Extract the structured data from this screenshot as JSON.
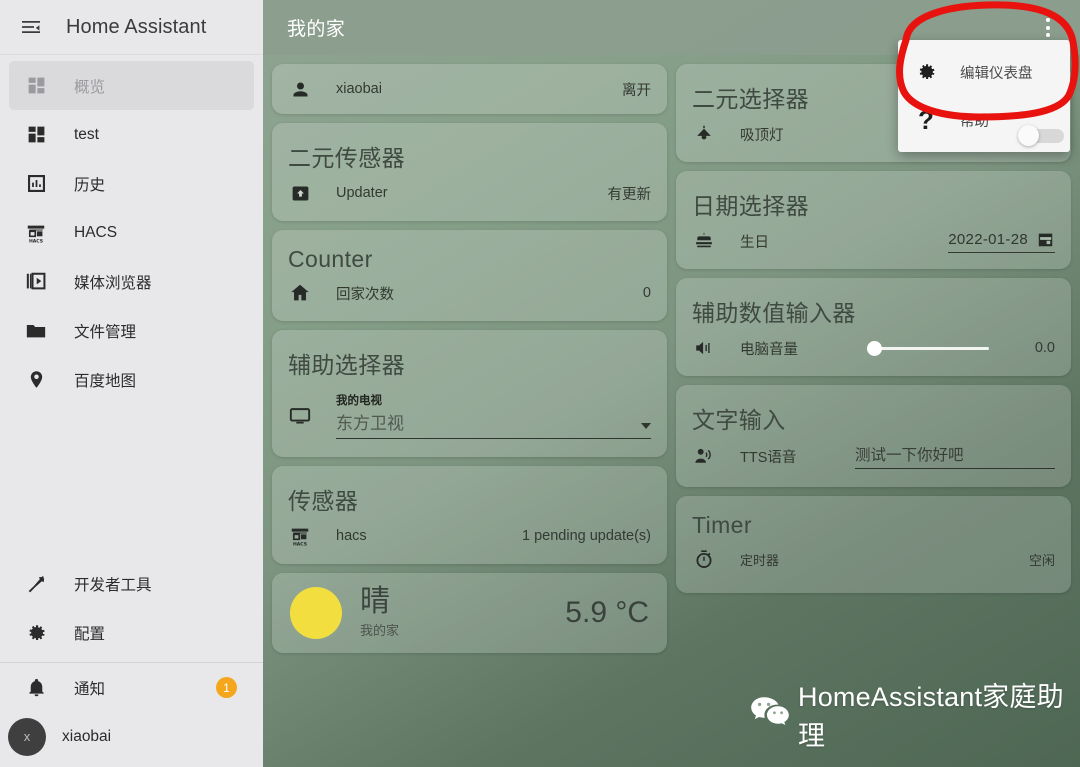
{
  "sidebar": {
    "title": "Home Assistant",
    "menu_icon": "hamburger-collapse-icon",
    "items": [
      {
        "label": "概览",
        "icon": "view-dashboard-icon",
        "active": true
      },
      {
        "label": "test",
        "icon": "view-dashboard-icon",
        "active": false
      },
      {
        "label": "历史",
        "icon": "chart-bar-icon",
        "active": false
      },
      {
        "label": "HACS",
        "icon": "hacs-store-icon",
        "active": false
      },
      {
        "label": "媒体浏览器",
        "icon": "media-library-icon",
        "active": false
      },
      {
        "label": "文件管理",
        "icon": "folder-icon",
        "active": false
      },
      {
        "label": "百度地图",
        "icon": "map-marker-icon",
        "active": false
      }
    ],
    "tools": [
      {
        "label": "开发者工具",
        "icon": "hammer-wrench-icon"
      },
      {
        "label": "配置",
        "icon": "cog-icon"
      }
    ],
    "notifications": {
      "label": "通知",
      "icon": "bell-icon",
      "badge": "1"
    },
    "user": {
      "label": "xiaobai",
      "avatar_initial": "x"
    }
  },
  "topbar": {
    "title": "我的家",
    "overflow_icon": "dots-vertical-icon"
  },
  "menu": {
    "items": [
      {
        "label": "编辑仪表盘",
        "icon": "cog-icon"
      },
      {
        "label": "帮助",
        "icon": "help-question-icon"
      }
    ],
    "toggle_state": "off"
  },
  "annotation": {
    "color": "#e8130f",
    "shape": "hand-drawn-ellipse"
  },
  "watermark": {
    "text": "HomeAssistant家庭助理",
    "icon": "wechat-icon",
    "color": "#ffffff"
  },
  "left_column": [
    {
      "type": "entities",
      "title": "",
      "rows": [
        {
          "icon": "account-icon",
          "name": "xiaobai",
          "value": "离开"
        }
      ]
    },
    {
      "type": "entities",
      "title": "二元传感器",
      "rows": [
        {
          "icon": "package-up-icon",
          "name": "Updater",
          "value": "有更新"
        }
      ]
    },
    {
      "type": "entities",
      "title": "Counter",
      "rows": [
        {
          "icon": "home-icon",
          "name": "回家次数",
          "value": "0"
        }
      ]
    },
    {
      "type": "select",
      "title": "辅助选择器",
      "rows": [
        {
          "icon": "television-icon",
          "label": "我的电视",
          "value": "东方卫视"
        }
      ]
    },
    {
      "type": "entities",
      "title": "传感器",
      "rows": [
        {
          "icon": "hacs-store-icon",
          "name": "hacs",
          "value": "1 pending update(s)"
        }
      ]
    },
    {
      "type": "weather",
      "condition": "晴",
      "location": "我的家",
      "temperature": "5.9 °C",
      "icon": "sunny-icon"
    }
  ],
  "right_column": [
    {
      "type": "entities",
      "title": "二元选择器",
      "rows": [
        {
          "icon": "ceiling-light-icon",
          "name": "吸顶灯",
          "value": ""
        }
      ]
    },
    {
      "type": "date",
      "title": "日期选择器",
      "rows": [
        {
          "icon": "cake-icon",
          "name": "生日",
          "value": "2022-01-28",
          "trailing_icon": "calendar-icon"
        }
      ]
    },
    {
      "type": "number",
      "title": "辅助数值输入器",
      "rows": [
        {
          "icon": "volume-high-icon",
          "name": "电脑音量",
          "value": "0.0",
          "slider_percent": 0
        }
      ]
    },
    {
      "type": "text",
      "title": "文字输入",
      "rows": [
        {
          "icon": "account-voice-icon",
          "name": "TTS语音",
          "value": "测试一下你好吧"
        }
      ]
    },
    {
      "type": "timer",
      "title": "Timer",
      "rows": [
        {
          "icon": "timer-icon",
          "name": "定时器",
          "value": "空闲"
        }
      ]
    }
  ]
}
